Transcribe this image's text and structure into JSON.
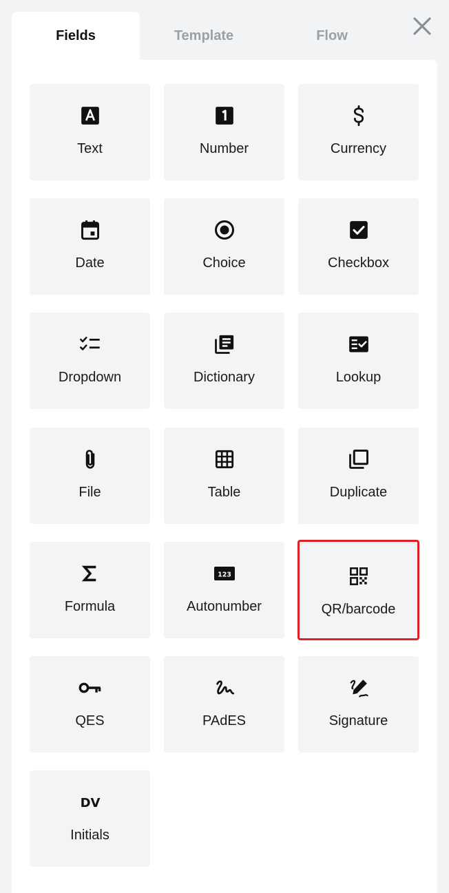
{
  "tabs": [
    {
      "label": "Fields",
      "active": true
    },
    {
      "label": "Template",
      "active": false
    },
    {
      "label": "Flow",
      "active": false
    }
  ],
  "close": {
    "icon": "close-icon"
  },
  "fields": [
    {
      "label": "Text",
      "icon": "text-icon"
    },
    {
      "label": "Number",
      "icon": "number-icon"
    },
    {
      "label": "Currency",
      "icon": "currency-icon"
    },
    {
      "label": "Date",
      "icon": "calendar-icon"
    },
    {
      "label": "Choice",
      "icon": "radio-icon"
    },
    {
      "label": "Checkbox",
      "icon": "checkbox-icon"
    },
    {
      "label": "Dropdown",
      "icon": "checklist-icon"
    },
    {
      "label": "Dictionary",
      "icon": "library-books-icon"
    },
    {
      "label": "Lookup",
      "icon": "fact-check-icon"
    },
    {
      "label": "File",
      "icon": "paperclip-icon"
    },
    {
      "label": "Table",
      "icon": "grid-icon"
    },
    {
      "label": "Duplicate",
      "icon": "copy-icon"
    },
    {
      "label": "Formula",
      "icon": "sigma-icon"
    },
    {
      "label": "Autonumber",
      "icon": "autonumber-icon"
    },
    {
      "label": "QR/barcode",
      "icon": "qr-code-icon",
      "selected": true
    },
    {
      "label": "QES",
      "icon": "key-icon"
    },
    {
      "label": "PAdES",
      "icon": "gesture-icon"
    },
    {
      "label": "Signature",
      "icon": "pen-signature-icon"
    },
    {
      "label": "Initials",
      "icon": "initials-icon",
      "icon_text": "DV"
    }
  ],
  "colors": {
    "selected_border": "#e02028",
    "tile_bg": "#f3f4f6",
    "page_bg": "#f2f3f5",
    "inactive_tab": "#9aa0a8"
  }
}
